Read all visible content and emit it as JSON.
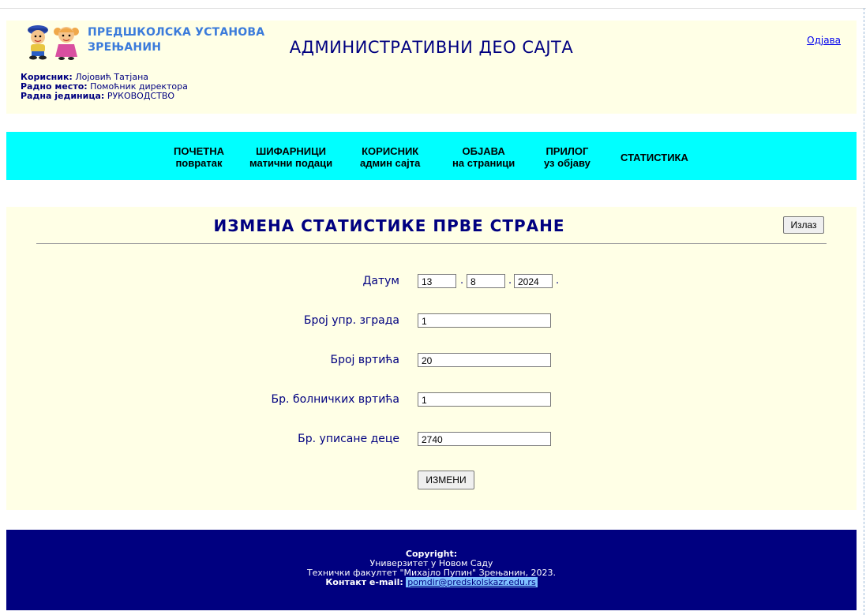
{
  "header": {
    "logo_text_line1": "ПРЕДШКОЛСКА УСТАНОВА",
    "logo_text_line2": "ЗРЕЊАНИН",
    "site_title": "АДМИНИСТРАТИВНИ ДЕО САЈТА",
    "logout_label": "Одјава",
    "user": {
      "user_label": "Корисник:",
      "user_value": "Лојовић Татјана",
      "position_label": "Радно место:",
      "position_value": "Помоћник директора",
      "unit_label": "Радна јединица:",
      "unit_value": "РУКОВОДСТВО"
    }
  },
  "nav": {
    "items": [
      {
        "line1": "ПОЧЕТНА",
        "line2": "повратак"
      },
      {
        "line1": "ШИФАРНИЦИ",
        "line2": "матични подаци"
      },
      {
        "line1": "КОРИСНИК",
        "line2": "админ сајта"
      },
      {
        "line1": "ОБЈАВА",
        "line2": "на страници"
      },
      {
        "line1": "ПРИЛОГ",
        "line2": "уз објаву"
      },
      {
        "line1": "СТАТИСТИКА",
        "line2": ""
      }
    ]
  },
  "main": {
    "title": "ИЗМЕНА СТАТИСТИКЕ ПРВЕ СТРАНЕ",
    "exit_label": "Излаз",
    "form": {
      "date_label": "Датум",
      "date_day": "13",
      "date_month": "8",
      "date_year": "2024",
      "buildings_label": "Број упр. зграда",
      "buildings_value": "1",
      "kindergartens_label": "Број вртића",
      "kindergartens_value": "20",
      "hospital_label": "Бр. болничких вртића",
      "hospital_value": "1",
      "children_label": "Бр. уписане деце",
      "children_value": "2740",
      "submit_label": "ИЗМЕНИ"
    }
  },
  "footer": {
    "copyright": "Copyright:",
    "line1": "Универзитет у Новом Саду",
    "line2": "Технички факултет \"Михајло Пупин\" Зрењанин, 2023.",
    "contact_label": "Контакт e-mail:",
    "email": "pomdir@predskolskazr.edu.rs"
  },
  "colors": {
    "header_bg": "#ffffe6",
    "nav_bg": "#00ffff",
    "footer_bg": "#000080",
    "title_color": "#000080",
    "logo_text_color": "#3b7bdb"
  }
}
